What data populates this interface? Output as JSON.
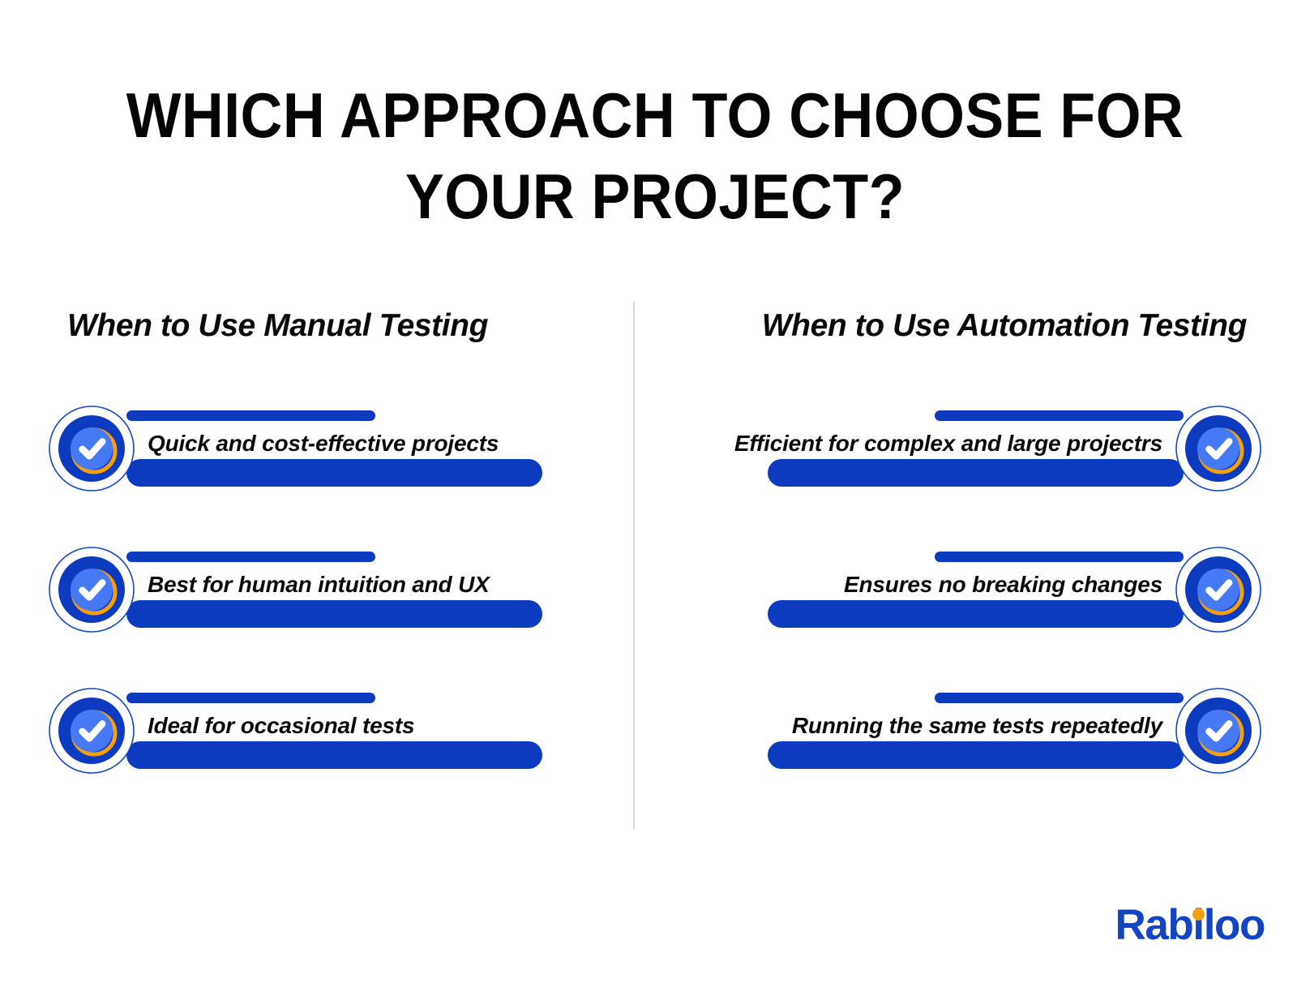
{
  "title": {
    "line1": "WHICH APPROACH TO CHOOSE FOR",
    "line2": "YOUR PROJECT?"
  },
  "columns": {
    "left": {
      "heading": "When to Use Manual Testing",
      "items": [
        {
          "label": "Quick and cost-effective projects"
        },
        {
          "label": "Best for human intuition and UX"
        },
        {
          "label": "Ideal for occasional tests"
        }
      ]
    },
    "right": {
      "heading": "When to Use Automation Testing",
      "items": [
        {
          "label": "Efficient for complex and large projectrs"
        },
        {
          "label": "Ensures no breaking changes"
        },
        {
          "label": "Running the same tests repeatedly"
        }
      ]
    }
  },
  "logo": {
    "part1": "Rab",
    "part2": "i",
    "part3": "loo"
  },
  "colors": {
    "background": "#ffffff",
    "primary_blue": "#0c3bc0",
    "light_blue": "#4579f5",
    "accent_orange": "#f6a009",
    "logo_blue": "#1344c4",
    "text_black": "#0b0b0b",
    "divider_gray": "#d9d9dc"
  }
}
